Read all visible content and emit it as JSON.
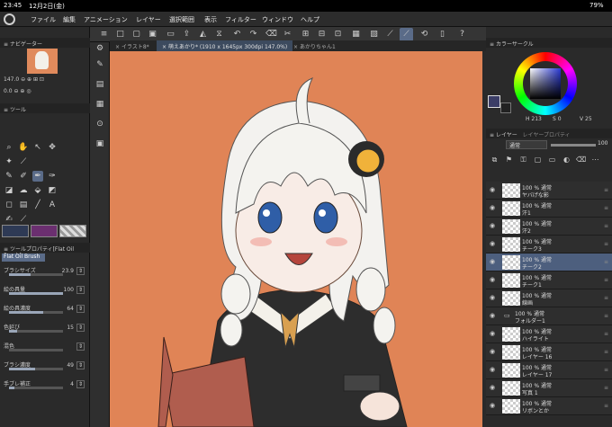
{
  "status": {
    "time": "23:45",
    "date": "12月2日(金)",
    "battery": "79%"
  },
  "menu": [
    "ファイル",
    "編集",
    "アニメーション",
    "レイヤー",
    "選択範囲",
    "表示",
    "フィルター",
    "ウィンドウ",
    "ヘルプ"
  ],
  "tabs": [
    "イラスト8*",
    "萌えあかり* (1910 x 1645px 300dpi 147.0%)",
    "あかりちゃん1"
  ],
  "navigator": {
    "title": "ナビゲーター",
    "zoom": "147.0",
    "angle": "0.0"
  },
  "tools": {
    "title": "ツール"
  },
  "tool_property": {
    "title": "ツールプロパティ[Flat Oil Brush]",
    "brush_name": "Flat Oil Brush",
    "rows": [
      {
        "label": "ブラシサイズ",
        "value": "23.9",
        "fill": 0.4
      },
      {
        "label": "絵の具量",
        "value": "100",
        "fill": 1.0
      },
      {
        "label": "絵の具濃度",
        "value": "64",
        "fill": 0.64
      },
      {
        "label": "色延び",
        "value": "15",
        "fill": 0.15
      },
      {
        "label": "混色",
        "value": "",
        "fill": 0
      },
      {
        "label": "ブラシ濃度",
        "value": "49",
        "fill": 0.49
      },
      {
        "label": "手ブレ補正",
        "value": "4",
        "fill": 0.1
      }
    ]
  },
  "color": {
    "title": "カラーサークル",
    "h": "213",
    "s": "0",
    "v": "25",
    "main": "#3b3d66"
  },
  "layer_panel": {
    "title": "レイヤー",
    "alt_title": "レイヤープロパティ",
    "blend": "通常",
    "opacity": "100"
  },
  "layers": [
    {
      "pct": "100 %",
      "mode": "通常",
      "name": "ヤバげな影",
      "selected": false,
      "folder": false
    },
    {
      "pct": "100 %",
      "mode": "通常",
      "name": "汗1",
      "selected": false,
      "folder": false
    },
    {
      "pct": "100 %",
      "mode": "通常",
      "name": "汗2",
      "selected": false,
      "folder": false
    },
    {
      "pct": "100 %",
      "mode": "通常",
      "name": "チーク3",
      "selected": false,
      "folder": false
    },
    {
      "pct": "100 %",
      "mode": "通常",
      "name": "チーク2",
      "selected": true,
      "folder": false
    },
    {
      "pct": "100 %",
      "mode": "通常",
      "name": "チーク1",
      "selected": false,
      "folder": false
    },
    {
      "pct": "100 %",
      "mode": "通常",
      "name": "線画",
      "selected": false,
      "folder": false
    },
    {
      "pct": "100 %",
      "mode": "通常",
      "name": "フォルダー1",
      "selected": false,
      "folder": true
    },
    {
      "pct": "100 %",
      "mode": "通常",
      "name": "ハイライト",
      "selected": false,
      "folder": false
    },
    {
      "pct": "100 %",
      "mode": "通常",
      "name": "レイヤー 16",
      "selected": false,
      "folder": false
    },
    {
      "pct": "100 %",
      "mode": "通常",
      "name": "レイヤー 17",
      "selected": false,
      "folder": false
    },
    {
      "pct": "100 %",
      "mode": "通常",
      "name": "写真 1",
      "selected": false,
      "folder": false
    },
    {
      "pct": "100 %",
      "mode": "通常",
      "name": "リボンとか",
      "selected": false,
      "folder": false
    }
  ],
  "colors": {
    "canvas_bg": "#e08456",
    "accent": "#5a6b88"
  }
}
